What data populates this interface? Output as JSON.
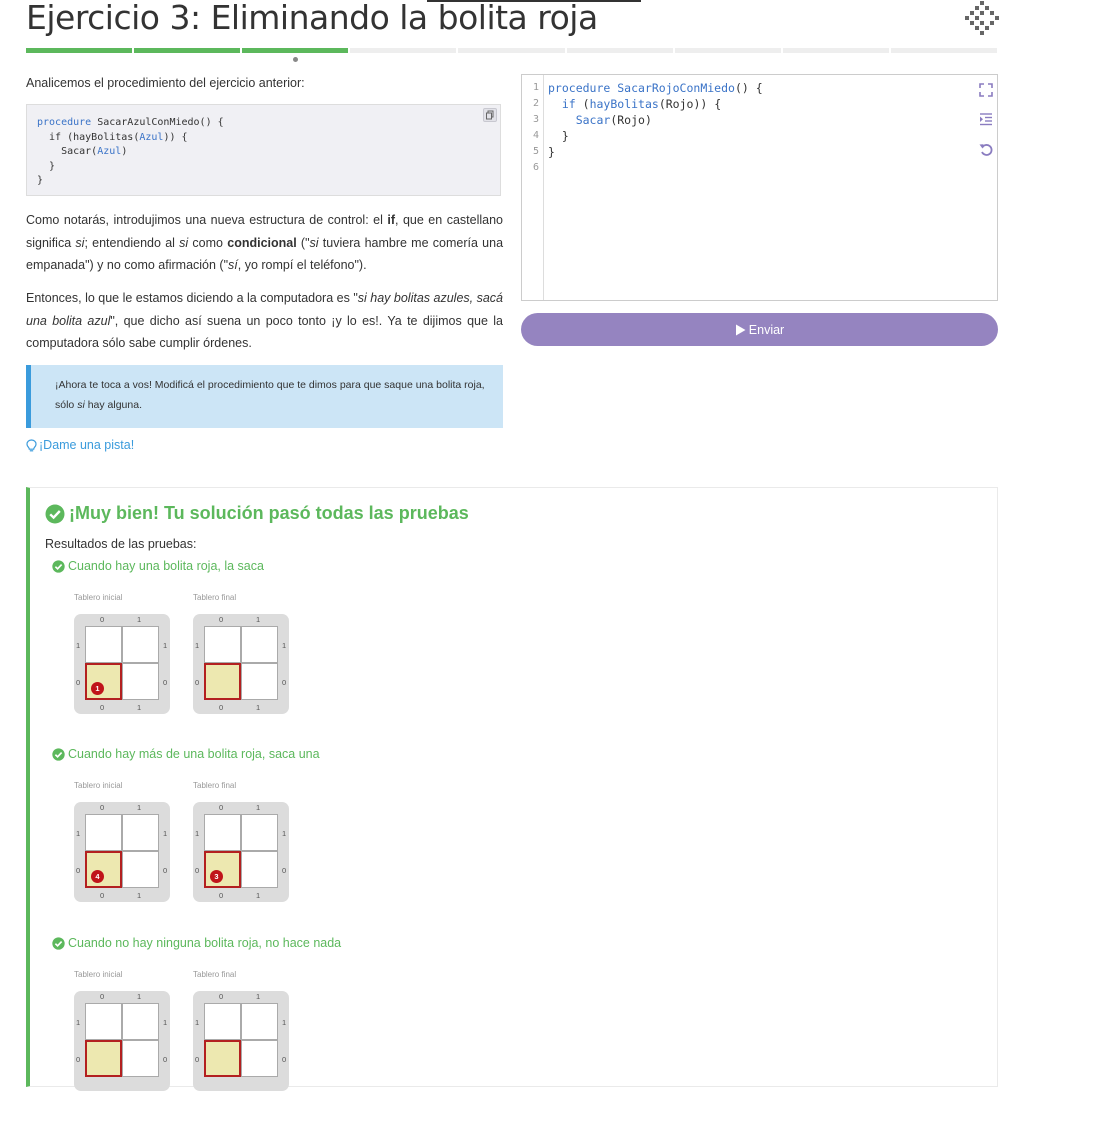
{
  "header": {
    "title": "Ejercicio 3: Eliminando la bolita roja",
    "progress_total": 9,
    "progress_completed": 3
  },
  "instructions": {
    "intro": "Analicemos el procedimiento del ejercicio anterior:",
    "code_sample": {
      "line1_kw": "procedure",
      "line1_rest": " SacarAzulConMiedo() {",
      "line2_pre": "  if (hayBolitas(",
      "line2_color": "Azul",
      "line2_post": ")) {",
      "line3_pre": "    Sacar(",
      "line3_color": "Azul",
      "line3_post": ")",
      "line4": "  }",
      "line5": "}"
    },
    "p1_a": "Como notarás, introdujimos una nueva estructura de control: el ",
    "p1_if": "if",
    "p1_b": ", que en castellano significa ",
    "p1_si1": "si",
    "p1_c": "; entendiendo al ",
    "p1_si2": "si",
    "p1_d": " como ",
    "p1_cond": "condicional",
    "p1_e": " (\"",
    "p1_si3": "si",
    "p1_f": " tuviera hambre me comería una empanada\") y no como afirmación (\"",
    "p1_si4": "sí",
    "p1_g": ", yo rompí el teléfono\").",
    "p2_a": "Entonces, lo que le estamos diciendo a la computadora es \"",
    "p2_em": "si hay bolitas azules, sacá una bolita azul",
    "p2_b": "\", que dicho así suena un poco tonto ¡y lo es!. Ya te dijimos que la computadora sólo sabe cumplir órdenes.",
    "notice_a": "¡Ahora te toca a vos! Modificá el procedimiento que te dimos para que saque una bolita roja, sólo ",
    "notice_si": "si",
    "notice_b": " hay alguna.",
    "hint": "¡Dame una pista!"
  },
  "editor": {
    "line_numbers": [
      "1",
      "2",
      "3",
      "4",
      "5",
      "6"
    ],
    "l1_kw": "procedure",
    "l1_fn": " SacarRojoConMiedo",
    "l1_rest": "() {",
    "l2_pre": "  ",
    "l2_kw": "if",
    "l2_mid": " (",
    "l2_fn": "hayBolitas",
    "l2_post": "(Rojo)) {",
    "l3_pre": "    ",
    "l3_fn": "Sacar",
    "l3_post": "(Rojo)",
    "l4": "  }",
    "l5": "}",
    "l6": ""
  },
  "submit": {
    "label": "Enviar"
  },
  "results": {
    "heading": "¡Muy bien! Tu solución pasó todas las pruebas",
    "subheading": "Resultados de las pruebas:",
    "initial_label": "Tablero inicial",
    "final_label": "Tablero final",
    "axis": {
      "c0": "0",
      "c1": "1",
      "r0": "0",
      "r1": "1"
    },
    "tests": [
      {
        "title": "Cuando hay una bolita roja, la saca",
        "initial_count": "1",
        "final_count": ""
      },
      {
        "title": "Cuando hay más de una bolita roja, saca una",
        "initial_count": "4",
        "final_count": "3"
      },
      {
        "title": "Cuando no hay ninguna bolita roja, no hace nada",
        "initial_count": "",
        "final_count": ""
      }
    ]
  },
  "colors": {
    "success": "#5cb85c",
    "submit": "#9584c0",
    "link": "#3a9bdc",
    "ball": "#c0141a"
  }
}
